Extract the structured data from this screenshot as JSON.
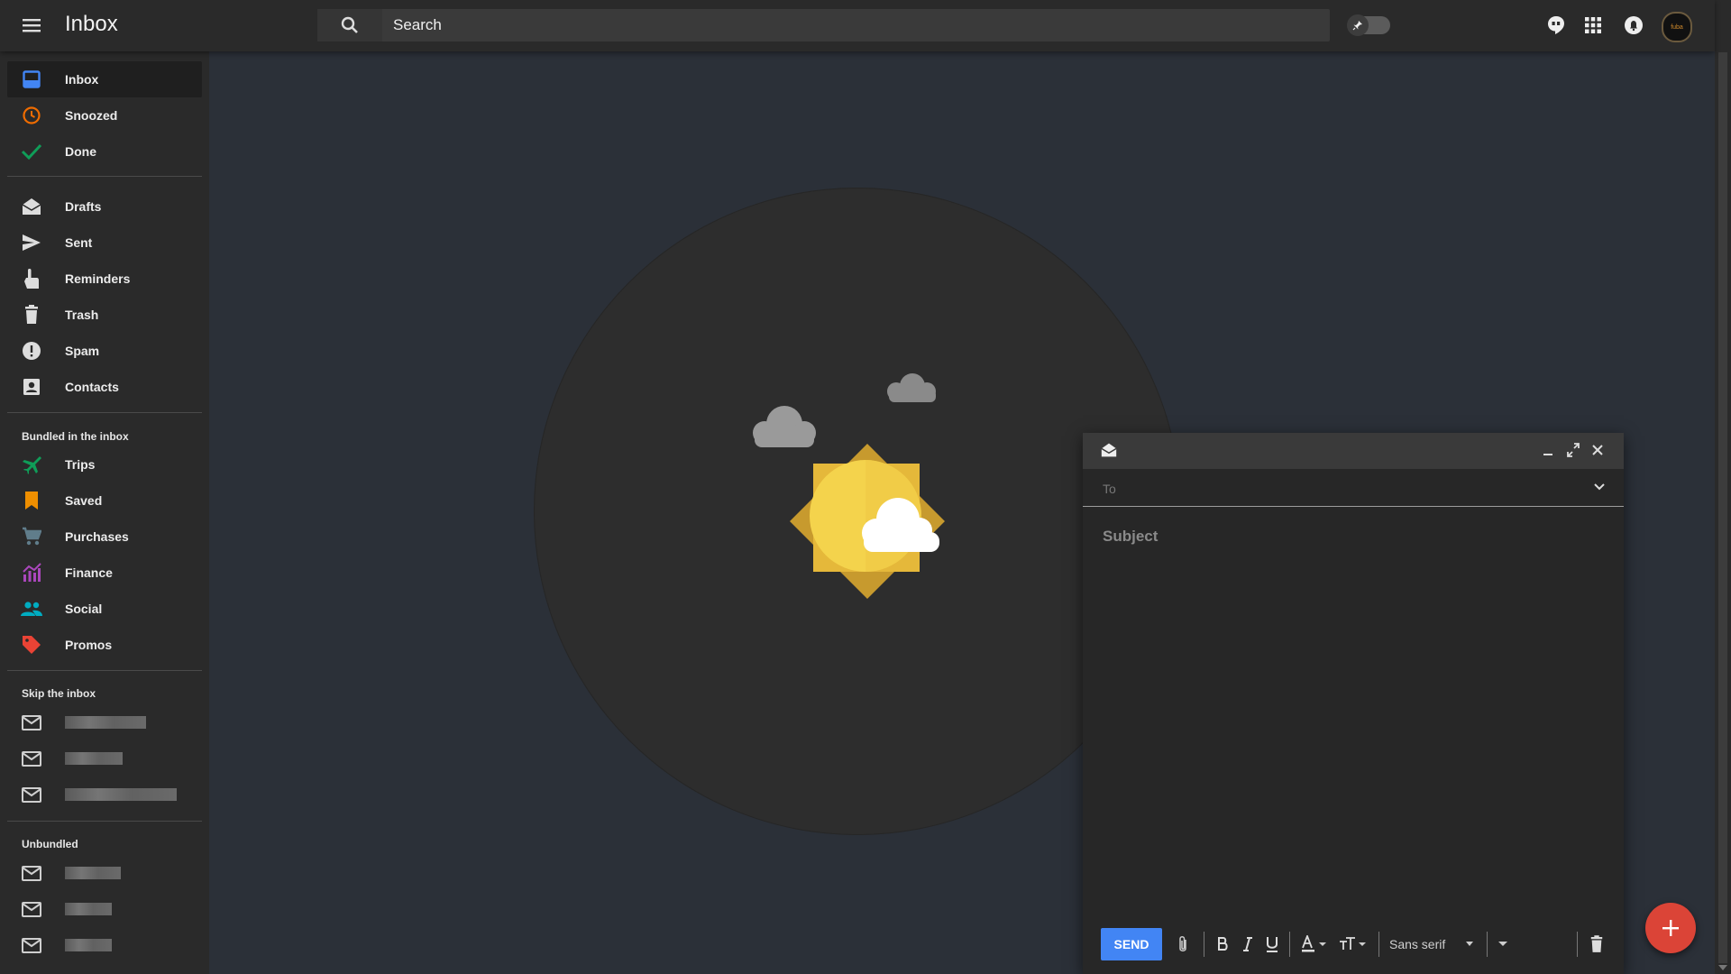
{
  "header": {
    "title": "Inbox",
    "search_placeholder": "Search",
    "avatar_text": "fuba"
  },
  "sidebar": {
    "primary": [
      {
        "label": "Inbox",
        "icon": "inbox-icon",
        "color": "#4285f4"
      },
      {
        "label": "Snoozed",
        "icon": "clock-icon",
        "color": "#ef6c00"
      },
      {
        "label": "Done",
        "icon": "check-icon",
        "color": "#0f9d58"
      }
    ],
    "secondary": [
      {
        "label": "Drafts",
        "icon": "drafts-icon"
      },
      {
        "label": "Sent",
        "icon": "send-icon"
      },
      {
        "label": "Reminders",
        "icon": "reminder-icon"
      },
      {
        "label": "Trash",
        "icon": "trash-icon"
      },
      {
        "label": "Spam",
        "icon": "spam-icon"
      },
      {
        "label": "Contacts",
        "icon": "contacts-icon"
      }
    ],
    "bundled_label": "Bundled in the inbox",
    "bundled": [
      {
        "label": "Trips",
        "icon": "plane-icon",
        "color": "#0f9d58"
      },
      {
        "label": "Saved",
        "icon": "bookmark-icon",
        "color": "#ef8f00"
      },
      {
        "label": "Purchases",
        "icon": "cart-icon",
        "color": "#607d8b"
      },
      {
        "label": "Finance",
        "icon": "finance-icon",
        "color": "#ab47bc"
      },
      {
        "label": "Social",
        "icon": "people-icon",
        "color": "#00acc1"
      },
      {
        "label": "Promos",
        "icon": "tag-icon",
        "color": "#ea4335"
      }
    ],
    "skip_label": "Skip the inbox",
    "unbundled_label": "Unbundled"
  },
  "compose": {
    "to_placeholder": "To",
    "subject_placeholder": "Subject",
    "send_label": "SEND",
    "font_label": "Sans serif"
  },
  "colors": {
    "accent": "#4285f4",
    "fab": "#db4437",
    "background": "#2b3038",
    "panel": "#2a2a2a"
  }
}
